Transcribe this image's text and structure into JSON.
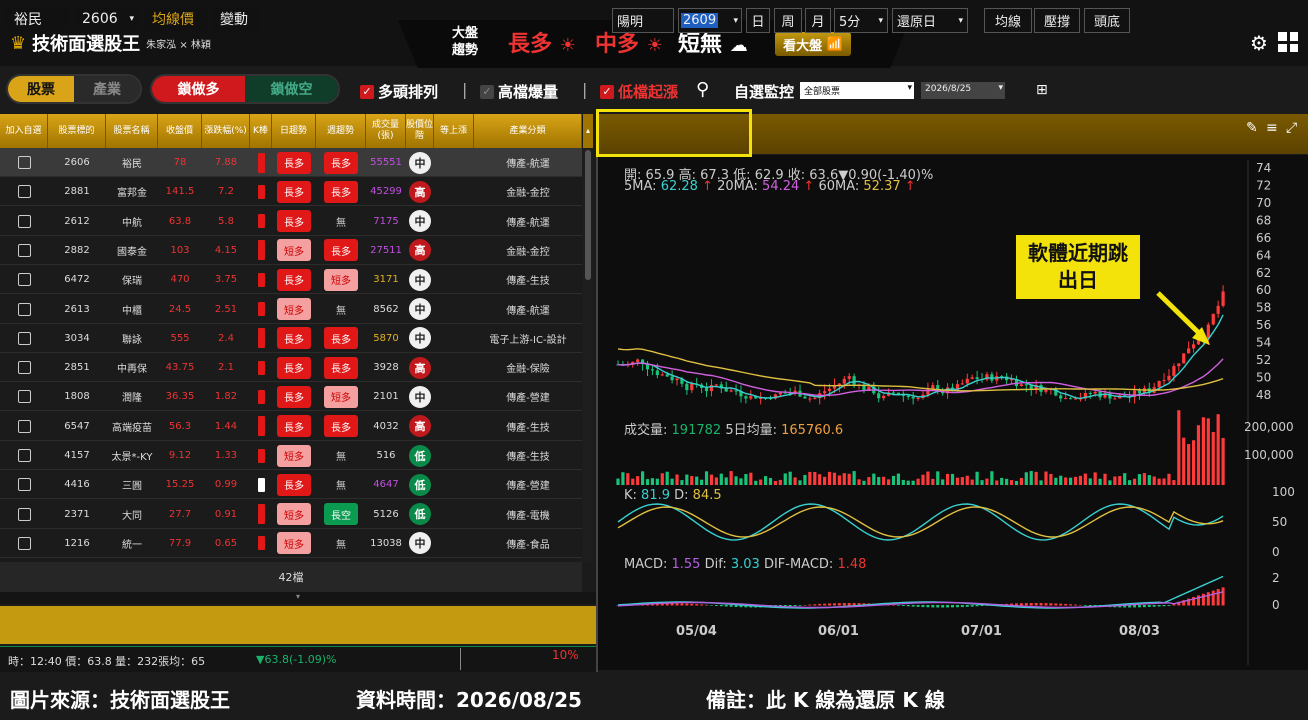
{
  "app": {
    "title": "技術面選股王",
    "authors": "朱家泓 × 林穎"
  },
  "trend": {
    "label": "大盤趨勢",
    "long": "長多",
    "mid": "中多",
    "short": "短無",
    "btn": "看大盤"
  },
  "toolbar": {
    "tab_stock": "股票",
    "tab_industry": "產業",
    "lock_long": "鎖做多",
    "lock_short": "鎖做空",
    "c1": "多頭排列",
    "c2": "高檔爆量",
    "c3": "低檔起漲",
    "watch": "自選監控",
    "select_value": "全部股票",
    "date": "2026/8/25"
  },
  "table": {
    "headers": [
      "加入自選",
      "股票標的",
      "股票名稱",
      "收盤價",
      "漲跌幅(%)",
      "K棒",
      "日趨勢",
      "週趨勢",
      "成交量(張)",
      "股價位階",
      "等上漲",
      "產業分類"
    ],
    "rows": [
      {
        "code": "2606",
        "name": "裕民",
        "price": "78",
        "chg": "7.88",
        "day": "長多",
        "week": "長多",
        "vol": "55551",
        "pos": "中",
        "ind": "傳產-航運"
      },
      {
        "code": "2881",
        "name": "富邦金",
        "price": "141.5",
        "chg": "7.2",
        "day": "長多",
        "week": "長多",
        "vol": "45299",
        "pos": "高",
        "ind": "金融-金控"
      },
      {
        "code": "2612",
        "name": "中航",
        "price": "63.8",
        "chg": "5.8",
        "day": "長多",
        "week": "無",
        "vol": "7175",
        "pos": "中",
        "ind": "傳產-航運"
      },
      {
        "code": "2882",
        "name": "國泰金",
        "price": "103",
        "chg": "4.15",
        "day": "短多",
        "week": "長多",
        "vol": "27511",
        "pos": "高",
        "ind": "金融-金控"
      },
      {
        "code": "6472",
        "name": "保瑞",
        "price": "470",
        "chg": "3.75",
        "day": "長多",
        "week": "短多",
        "vol": "3171",
        "pos": "中",
        "ind": "傳產-生技"
      },
      {
        "code": "2613",
        "name": "中櫃",
        "price": "24.5",
        "chg": "2.51",
        "day": "短多",
        "week": "無",
        "vol": "8562",
        "pos": "中",
        "ind": "傳產-航運"
      },
      {
        "code": "3034",
        "name": "聯詠",
        "price": "555",
        "chg": "2.4",
        "day": "長多",
        "week": "長多",
        "vol": "5870",
        "pos": "中",
        "ind": "電子上游-IC-設計"
      },
      {
        "code": "2851",
        "name": "中再保",
        "price": "43.75",
        "chg": "2.1",
        "day": "長多",
        "week": "長多",
        "vol": "3928",
        "pos": "高",
        "ind": "金融-保險"
      },
      {
        "code": "1808",
        "name": "潤隆",
        "price": "36.35",
        "chg": "1.82",
        "day": "長多",
        "week": "短多",
        "vol": "2101",
        "pos": "中",
        "ind": "傳產-營建"
      },
      {
        "code": "6547",
        "name": "高端疫苗",
        "price": "56.3",
        "chg": "1.44",
        "day": "長多",
        "week": "長多",
        "vol": "4032",
        "pos": "高",
        "ind": "傳產-生技"
      },
      {
        "code": "4157",
        "name": "太景*-KY",
        "price": "9.12",
        "chg": "1.33",
        "day": "短多",
        "week": "無",
        "vol": "516",
        "pos": "低",
        "ind": "傳產-生技"
      },
      {
        "code": "4416",
        "name": "三圓",
        "price": "15.25",
        "chg": "0.99",
        "day": "長多",
        "week": "無",
        "vol": "4647",
        "pos": "低",
        "ind": "傳產-營建"
      },
      {
        "code": "2371",
        "name": "大同",
        "price": "27.7",
        "chg": "0.91",
        "day": "短多",
        "week": "長空",
        "vol": "5126",
        "pos": "低",
        "ind": "傳產-電機"
      },
      {
        "code": "1216",
        "name": "統一",
        "price": "77.9",
        "chg": "0.65",
        "day": "短多",
        "week": "無",
        "vol": "13038",
        "pos": "中",
        "ind": "傳產-食品"
      }
    ],
    "count": "42檔"
  },
  "bottom": {
    "name": "裕民",
    "code": "2606",
    "btn1": "均線價",
    "btn2": "變動",
    "tick": "時：12:40 價：63.8 量：232張均：65",
    "tick_chg": "▼63.8(-1.09)%",
    "pct": "10%"
  },
  "chartbar": {
    "name": "陽明",
    "code": "2609",
    "b1": "日",
    "b2": "周",
    "b3": "月",
    "period": "5分",
    "restore": "還原日",
    "t1": "均線",
    "t2": "壓撐",
    "t3": "頭底"
  },
  "chart_data": {
    "type": "line",
    "ohlc": "開: 65.9  高: 67.3  低: 62.9  收: 63.6▼0.90(-1.40)%",
    "ma": {
      "ma5_label": "5MA:",
      "ma5": "62.28",
      "ma20_label": "20MA:",
      "ma20": "54.24",
      "ma60_label": "60MA:",
      "ma60": "52.37"
    },
    "price_ticks": [
      "74",
      "72",
      "70",
      "68",
      "66",
      "64",
      "62",
      "60",
      "58",
      "56",
      "54",
      "52",
      "50",
      "48"
    ],
    "vol_label": "成交量:",
    "vol": "191782",
    "vol5_label": "5日均量:",
    "vol5": "165760.6",
    "vol_ticks": [
      "200,000",
      "100,000"
    ],
    "kd_label": "K:",
    "k": "81.9",
    "d_label": "D:",
    "d": "84.5",
    "kd_ticks": [
      "100",
      "50",
      "0"
    ],
    "macd_label": "MACD:",
    "macd": "1.55",
    "dif_label": "Dif:",
    "dif": "3.03",
    "osc_label": "DIF-MACD:",
    "osc": "1.48",
    "macd_ticks": [
      "2",
      "0"
    ],
    "x_ticks": [
      "05/04",
      "06/01",
      "07/01",
      "08/03"
    ],
    "annotation": "軟體近期跳出日"
  },
  "footer": {
    "source": "圖片來源：技術面選股王",
    "time": "資料時間：2026/08/25",
    "note": "備註：此 K 線為還原 K 線"
  }
}
